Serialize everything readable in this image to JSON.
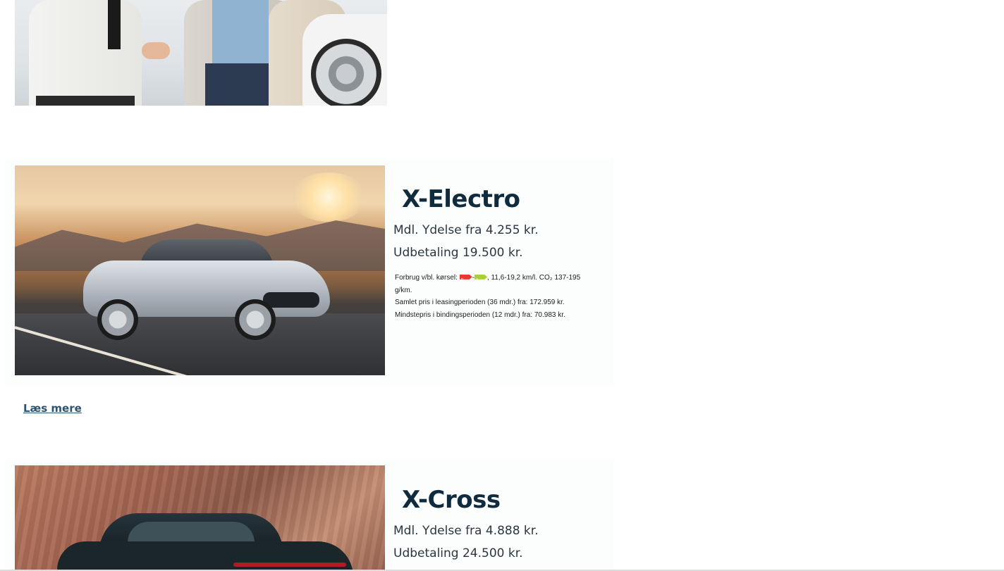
{
  "products": [
    {
      "title": "X-Electro",
      "monthly": "Mdl. Ydelse fra 4.255 kr.",
      "down_payment": "Udbetaling 19.500 kr.",
      "fine_print": {
        "consumption_label": "Forbrug v/bl. kørsel:",
        "energy_from": "D",
        "energy_to": "A",
        "consumption_value": ", 11,6-19,2 km/l. CO₂ 137-195 g/km.",
        "total_price": "Samlet pris i leasingperioden (36 mdr.) fra: 172.959 kr.",
        "min_price": "Mindstepris i bindingsperioden (12 mdr.) fra: 70.983 kr."
      },
      "read_more": "Læs mere"
    },
    {
      "title": "X-Cross",
      "monthly": "Mdl. Ydelse fra 4.888 kr.",
      "down_payment": "Udbetaling 24.500 kr."
    }
  ],
  "colors": {
    "title": "#102a3e",
    "link": "#2e5272",
    "energy_red": "#e53a30",
    "energy_green": "#a8cf3a"
  }
}
